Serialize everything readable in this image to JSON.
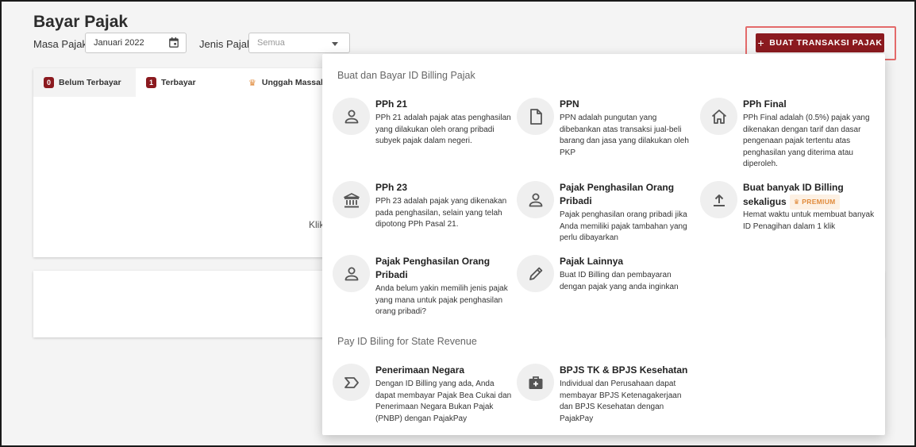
{
  "page": {
    "title": "Bayar Pajak",
    "masa_label": "Masa Pajak",
    "masa_value": "Januari 2022",
    "jenis_label": "Jenis Pajak",
    "jenis_placeholder": "Semua",
    "create_button": "BUAT TRANSAKSI PAJAK",
    "create_button_icon": "+"
  },
  "tabs": [
    {
      "label": "Belum Terbayar",
      "count": "0"
    },
    {
      "label": "Terbayar",
      "count": "1"
    },
    {
      "label": "Unggah Massal",
      "icon": "crown-icon"
    }
  ],
  "background_text": "Klik",
  "dropdown": {
    "section1_title": "Buat dan Bayar ID Billing Pajak",
    "section2_title": "Pay ID Biling for State Revenue",
    "premium_label": "PREMIUM",
    "items": [
      {
        "title": "PPh 21",
        "desc": "PPh 21 adalah pajak atas penghasilan yang dilakukan oleh orang pribadi subyek pajak dalam negeri.",
        "icon": "person-icon"
      },
      {
        "title": "PPN",
        "desc": "PPN adalah pungutan yang dibebankan atas transaksi jual-beli barang dan jasa yang dilakukan oleh PKP",
        "icon": "document-icon"
      },
      {
        "title": "PPh Final",
        "desc": "PPh Final adalah (0.5%) pajak yang dikenakan dengan tarif dan dasar pengenaan pajak tertentu atas penghasilan yang diterima atau diperoleh.",
        "icon": "home-icon"
      },
      {
        "title": "PPh 23",
        "desc": "PPh 23 adalah pajak yang dikenakan pada penghasilan, selain yang telah dipotong PPh Pasal 21.",
        "icon": "bank-icon"
      },
      {
        "title": "Pajak Penghasilan Orang Pribadi",
        "desc": "Pajak penghasilan orang pribadi jika Anda memiliki pajak tambahan yang perlu dibayarkan",
        "icon": "person-icon"
      },
      {
        "title": "Buat banyak ID Billing sekaligus",
        "desc": "Hemat waktu untuk membuat banyak ID Penagihan dalam 1 klik",
        "icon": "upload-icon"
      },
      {
        "title": "Pajak Penghasilan Orang Pribadi",
        "desc": "Anda belum yakin memilih jenis pajak yang mana untuk pajak penghasilan orang pribadi?",
        "icon": "person-icon"
      },
      {
        "title": "Pajak Lainnya",
        "desc": "Buat ID Billing dan pembayaran dengan pajak yang anda inginkan",
        "icon": "pencil-icon"
      },
      {
        "title": "Penerimaan Negara",
        "desc": "Dengan ID Billing yang ada, Anda dapat membayar Pajak Bea Cukai dan Penerimaan Negara Bukan Pajak (PNBP) dengan PajakPay",
        "icon": "chevron-tag-icon"
      },
      {
        "title": "BPJS TK & BPJS Kesehatan",
        "desc": "Individual dan Perusahaan dapat membayar BPJS Ketenagakerjaan dan BPJS Kesehatan dengan PajakPay",
        "icon": "medical-kit-icon"
      }
    ]
  },
  "colors": {
    "primary": "#8b1a1f",
    "highlight": "#e36a6a",
    "premium": "#e08a3a"
  }
}
